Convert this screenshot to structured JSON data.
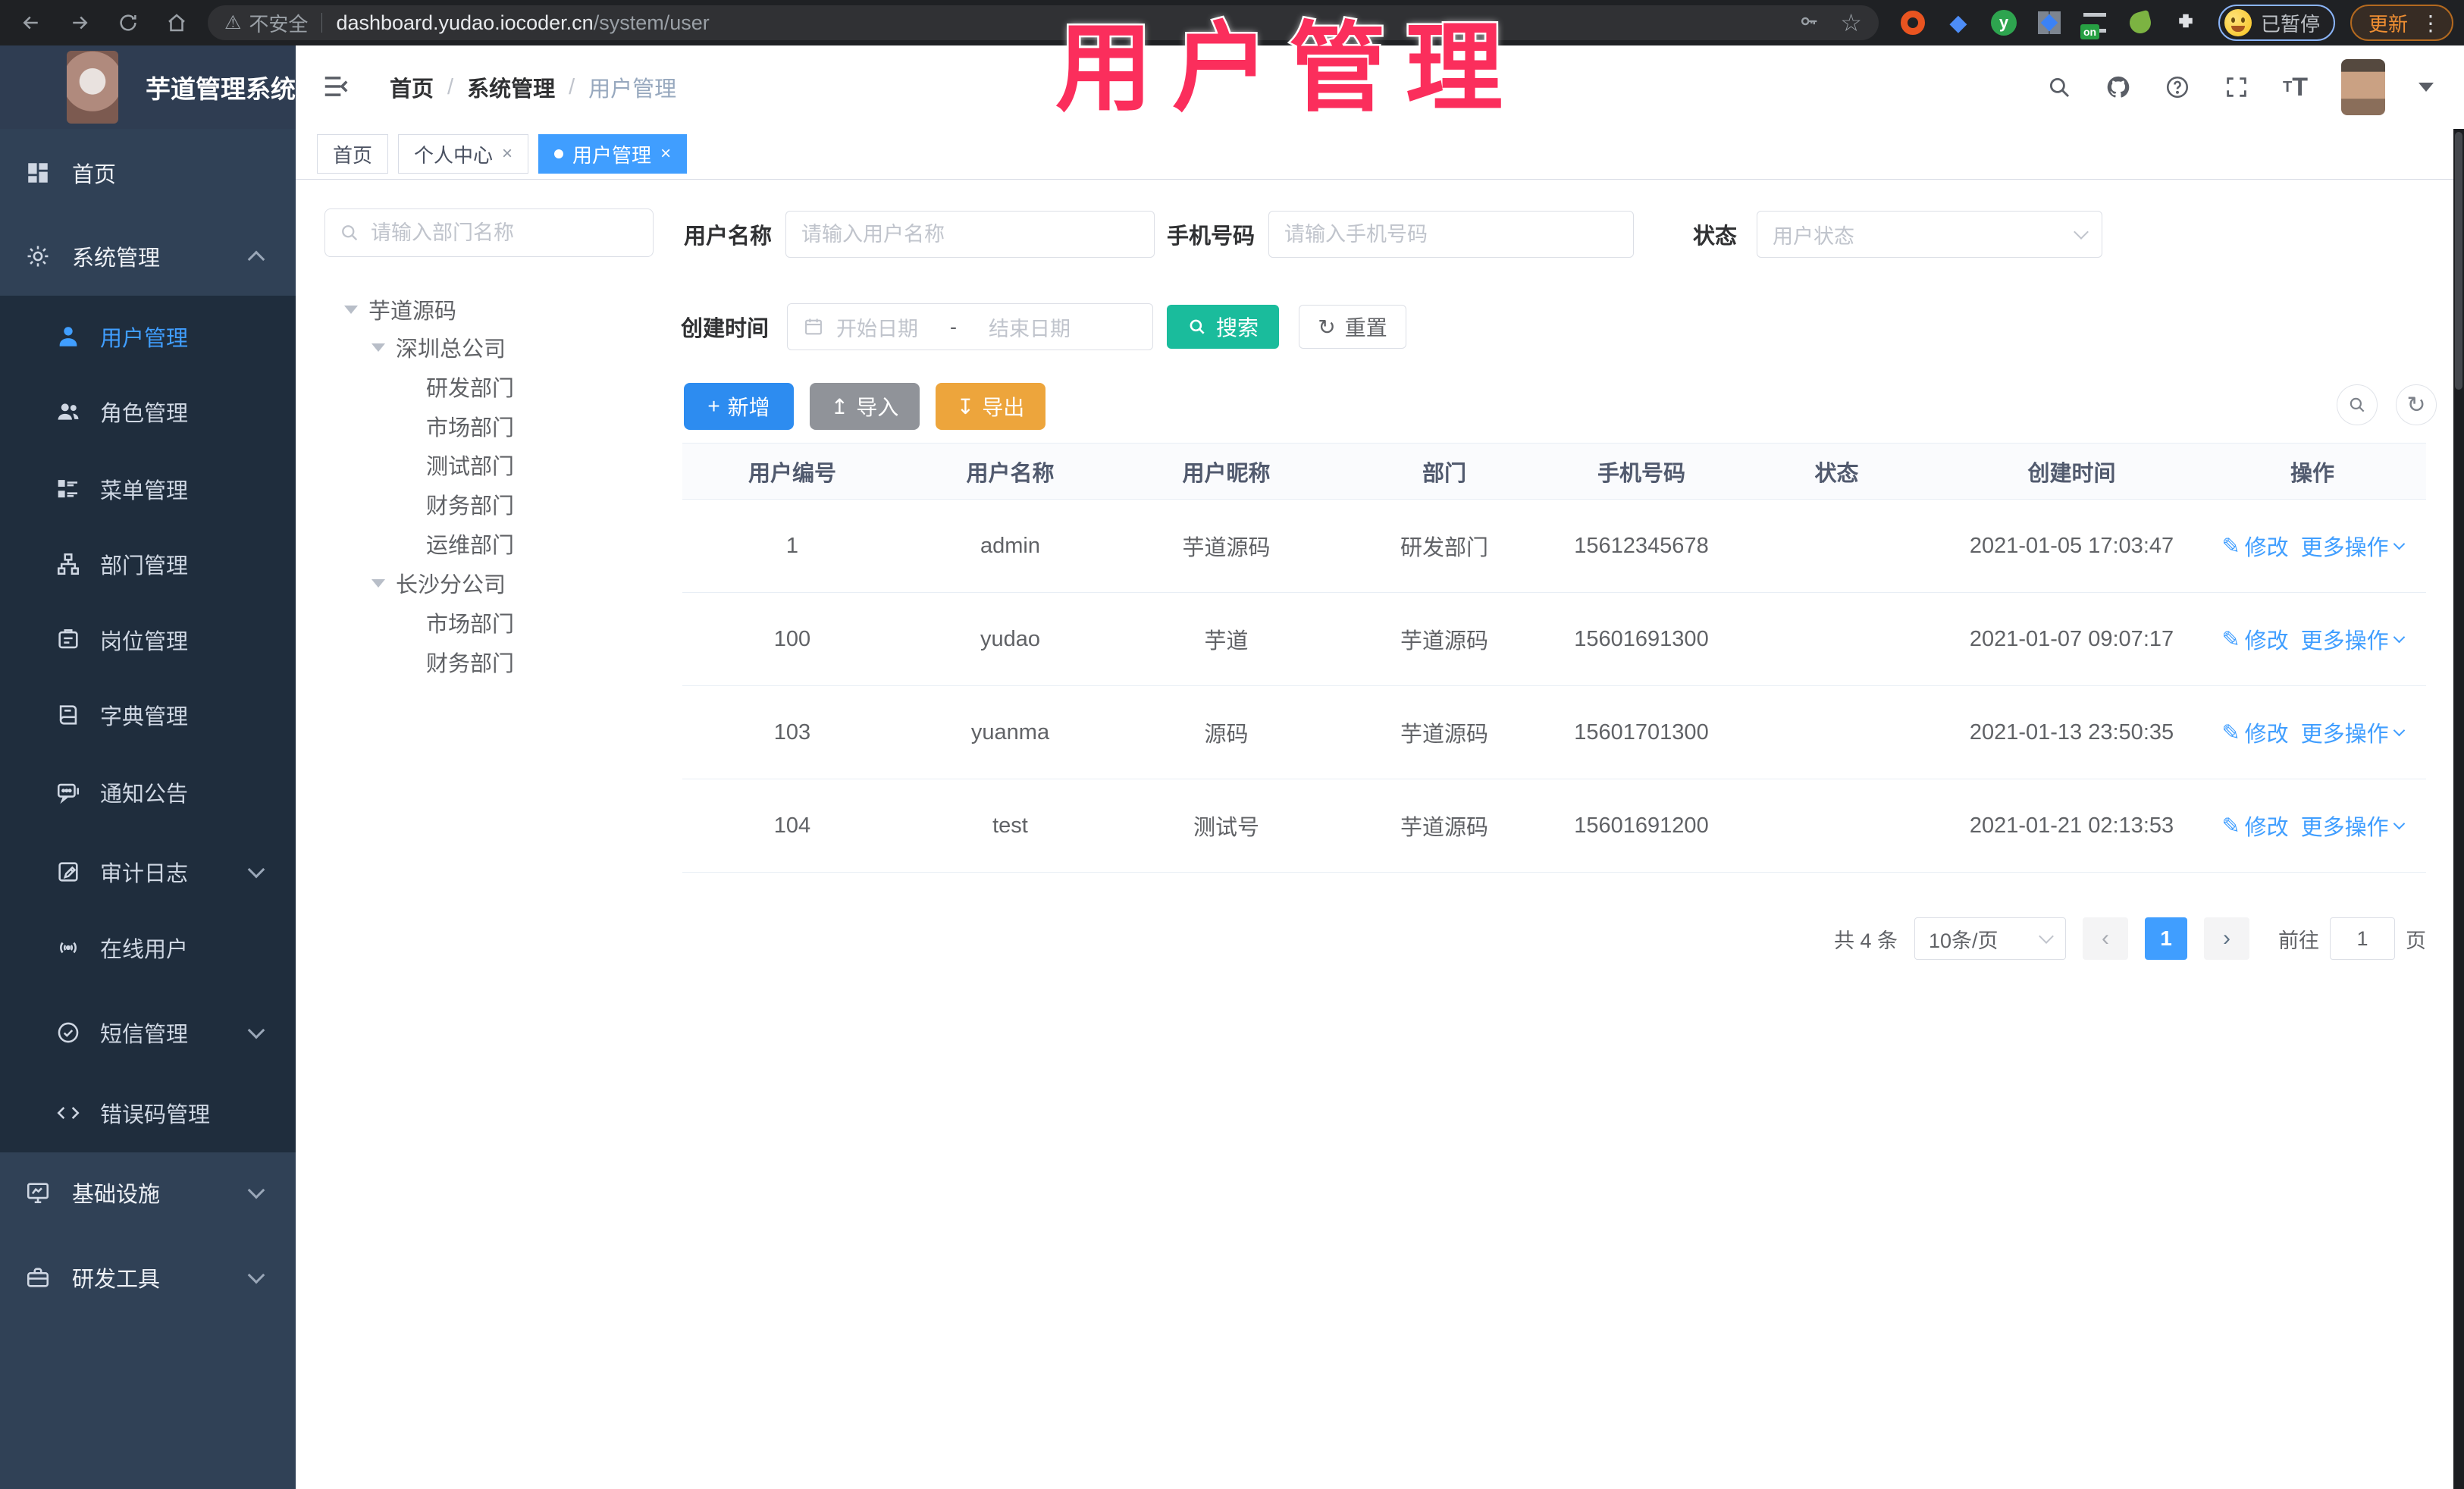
{
  "overlay_title": "用户管理",
  "browser": {
    "security_label": "不安全",
    "url_host": "dashboard.yudao.iocoder.cn",
    "url_path": "/system/user",
    "extension_on_badge": "on",
    "extension_y_label": "y",
    "profile_chip_label": "已暂停",
    "update_button_label": "更新"
  },
  "glyphs": {
    "warning": "⚠",
    "star": "☆",
    "dots_menu": "⋮",
    "close": "×",
    "edit_pen": "✎",
    "plus": "+",
    "import_arrow": "↥",
    "export_arrow": "↧",
    "reset_refresh": "↻",
    "refresh": "↻",
    "prev": "‹",
    "next": "›",
    "breadcrumb_sep": "/",
    "date_sep": "-",
    "font_size_small": "T",
    "font_size_big": "T",
    "help_mark": "?"
  },
  "header": {
    "app_title": "芋道管理系统",
    "breadcrumb": [
      {
        "label": "首页"
      },
      {
        "label": "系统管理"
      },
      {
        "label": "用户管理"
      }
    ]
  },
  "tabs": [
    {
      "label": "首页"
    },
    {
      "label": "个人中心"
    },
    {
      "label": "用户管理"
    }
  ],
  "sidebar": {
    "items": [
      {
        "label": "首页"
      },
      {
        "label": "系统管理"
      },
      {
        "label": "用户管理"
      },
      {
        "label": "角色管理"
      },
      {
        "label": "菜单管理"
      },
      {
        "label": "部门管理"
      },
      {
        "label": "岗位管理"
      },
      {
        "label": "字典管理"
      },
      {
        "label": "通知公告"
      },
      {
        "label": "审计日志"
      },
      {
        "label": "在线用户"
      },
      {
        "label": "短信管理"
      },
      {
        "label": "错误码管理"
      },
      {
        "label": "基础设施"
      },
      {
        "label": "研发工具"
      }
    ]
  },
  "dept_panel": {
    "search_placeholder": "请输入部门名称",
    "tree": [
      {
        "label": "芋道源码"
      },
      {
        "label": "深圳总公司"
      },
      {
        "label": "研发部门"
      },
      {
        "label": "市场部门"
      },
      {
        "label": "测试部门"
      },
      {
        "label": "财务部门"
      },
      {
        "label": "运维部门"
      },
      {
        "label": "长沙分公司"
      },
      {
        "label": "市场部门"
      },
      {
        "label": "财务部门"
      }
    ]
  },
  "filters": {
    "username_label": "用户名称",
    "username_placeholder": "请输入用户名称",
    "mobile_label": "手机号码",
    "mobile_placeholder": "请输入手机号码",
    "status_label": "状态",
    "status_placeholder": "用户状态",
    "create_time_label": "创建时间",
    "date_start_placeholder": "开始日期",
    "date_end_placeholder": "结束日期",
    "search_button": "搜索",
    "reset_button": "重置"
  },
  "toolbar": {
    "add_button": "新增",
    "import_button": "导入",
    "export_button": "导出"
  },
  "table": {
    "columns": [
      "用户编号",
      "用户名称",
      "用户昵称",
      "部门",
      "手机号码",
      "状态",
      "创建时间",
      "操作"
    ],
    "row_actions": {
      "edit": "修改",
      "more": "更多操作"
    },
    "rows": [
      {
        "id": "1",
        "username": "admin",
        "nickname": "芋道源码",
        "dept": "研发部门",
        "mobile": "15612345678",
        "status_on": true,
        "create_time": "2021-01-05 17:03:47"
      },
      {
        "id": "100",
        "username": "yudao",
        "nickname": "芋道",
        "dept": "芋道源码",
        "mobile": "15601691300",
        "status_on": false,
        "create_time": "2021-01-07 09:07:17"
      },
      {
        "id": "103",
        "username": "yuanma",
        "nickname": "源码",
        "dept": "芋道源码",
        "mobile": "15601701300",
        "status_on": true,
        "create_time": "2021-01-13 23:50:35"
      },
      {
        "id": "104",
        "username": "test",
        "nickname": "测试号",
        "dept": "芋道源码",
        "mobile": "15601691200",
        "status_on": true,
        "create_time": "2021-01-21 02:13:53"
      }
    ]
  },
  "pagination": {
    "total_text": "共 4 条",
    "page_size": "10条/页",
    "current_page": "1",
    "goto_label": "前往",
    "goto_value": "1",
    "page_unit": "页"
  },
  "colors": {
    "accent_blue": "#409eff",
    "search_teal": "#1abc9c",
    "export_amber": "#eda53c",
    "import_gray": "#909399",
    "sidebar_bg": "#304156",
    "submenu_bg": "#1f2d3d",
    "overlay_pink": "#fb2e5c",
    "chrome_bar": "#1f2124"
  }
}
